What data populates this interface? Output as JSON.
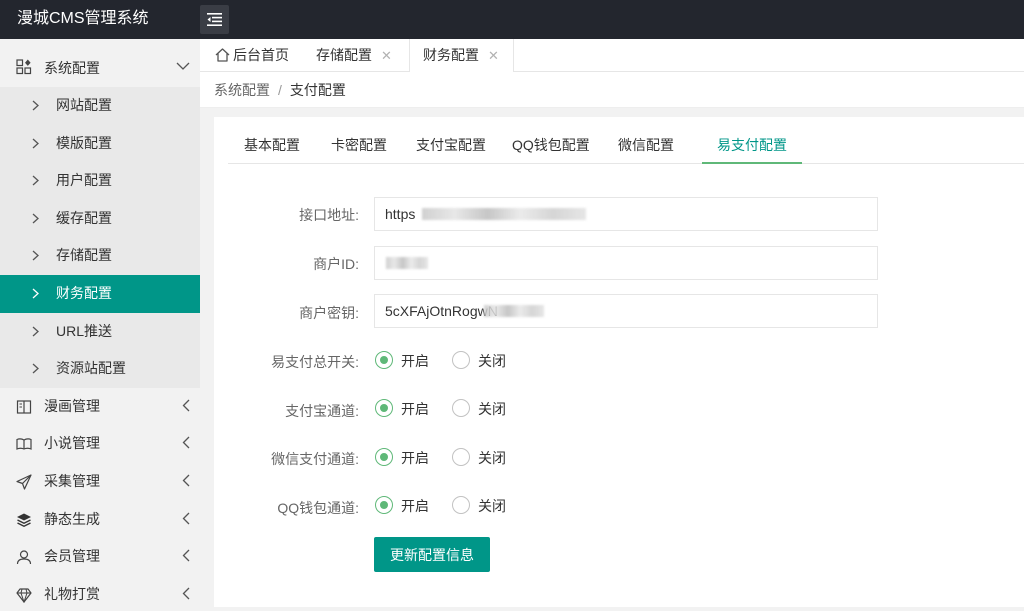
{
  "header": {
    "logo": "漫城CMS管理系统",
    "menu_toggle_icon": "menu-fold-icon"
  },
  "sidebar": {
    "system_config": {
      "label": "系统配置",
      "icon": "apps-icon",
      "children": [
        {
          "label": "网站配置"
        },
        {
          "label": "模版配置"
        },
        {
          "label": "用户配置"
        },
        {
          "label": "缓存配置"
        },
        {
          "label": "存储配置"
        },
        {
          "label": "财务配置"
        },
        {
          "label": "URL推送"
        },
        {
          "label": "资源站配置"
        }
      ]
    },
    "items": [
      {
        "label": "漫画管理",
        "icon": "comic-icon"
      },
      {
        "label": "小说管理",
        "icon": "book-icon"
      },
      {
        "label": "采集管理",
        "icon": "send-icon"
      },
      {
        "label": "静态生成",
        "icon": "layers-icon"
      },
      {
        "label": "会员管理",
        "icon": "user-icon"
      },
      {
        "label": "礼物打赏",
        "icon": "diamond-icon"
      }
    ]
  },
  "page_tabs": [
    {
      "label": "后台首页"
    },
    {
      "label": "存储配置",
      "close": "✕"
    },
    {
      "label": "财务配置",
      "close": "✕"
    }
  ],
  "breadcrumb": {
    "parent": "系统配置",
    "separator": "/",
    "current": "支付配置"
  },
  "config_tabs": [
    "基本配置",
    "卡密配置",
    "支付宝配置",
    "QQ钱包配置",
    "微信配置",
    "易支付配置"
  ],
  "form": {
    "api_url": {
      "label": "接口地址:",
      "value": "https"
    },
    "merchant_id": {
      "label": "商户ID:",
      "value": ""
    },
    "merchant_key": {
      "label": "商户密钥:",
      "value": "5cXFAjOtnRogwN"
    },
    "switches": [
      {
        "label": "易支付总开关:",
        "on": "开启",
        "off": "关闭"
      },
      {
        "label": "支付宝通道:",
        "on": "开启",
        "off": "关闭"
      },
      {
        "label": "微信支付通道:",
        "on": "开启",
        "off": "关闭"
      },
      {
        "label": "QQ钱包通道:",
        "on": "开启",
        "off": "关闭"
      }
    ],
    "submit_label": "更新配置信息"
  },
  "colors": {
    "primary": "#009688",
    "radio_checked": "#5FB878",
    "header_bg": "#23262e"
  }
}
